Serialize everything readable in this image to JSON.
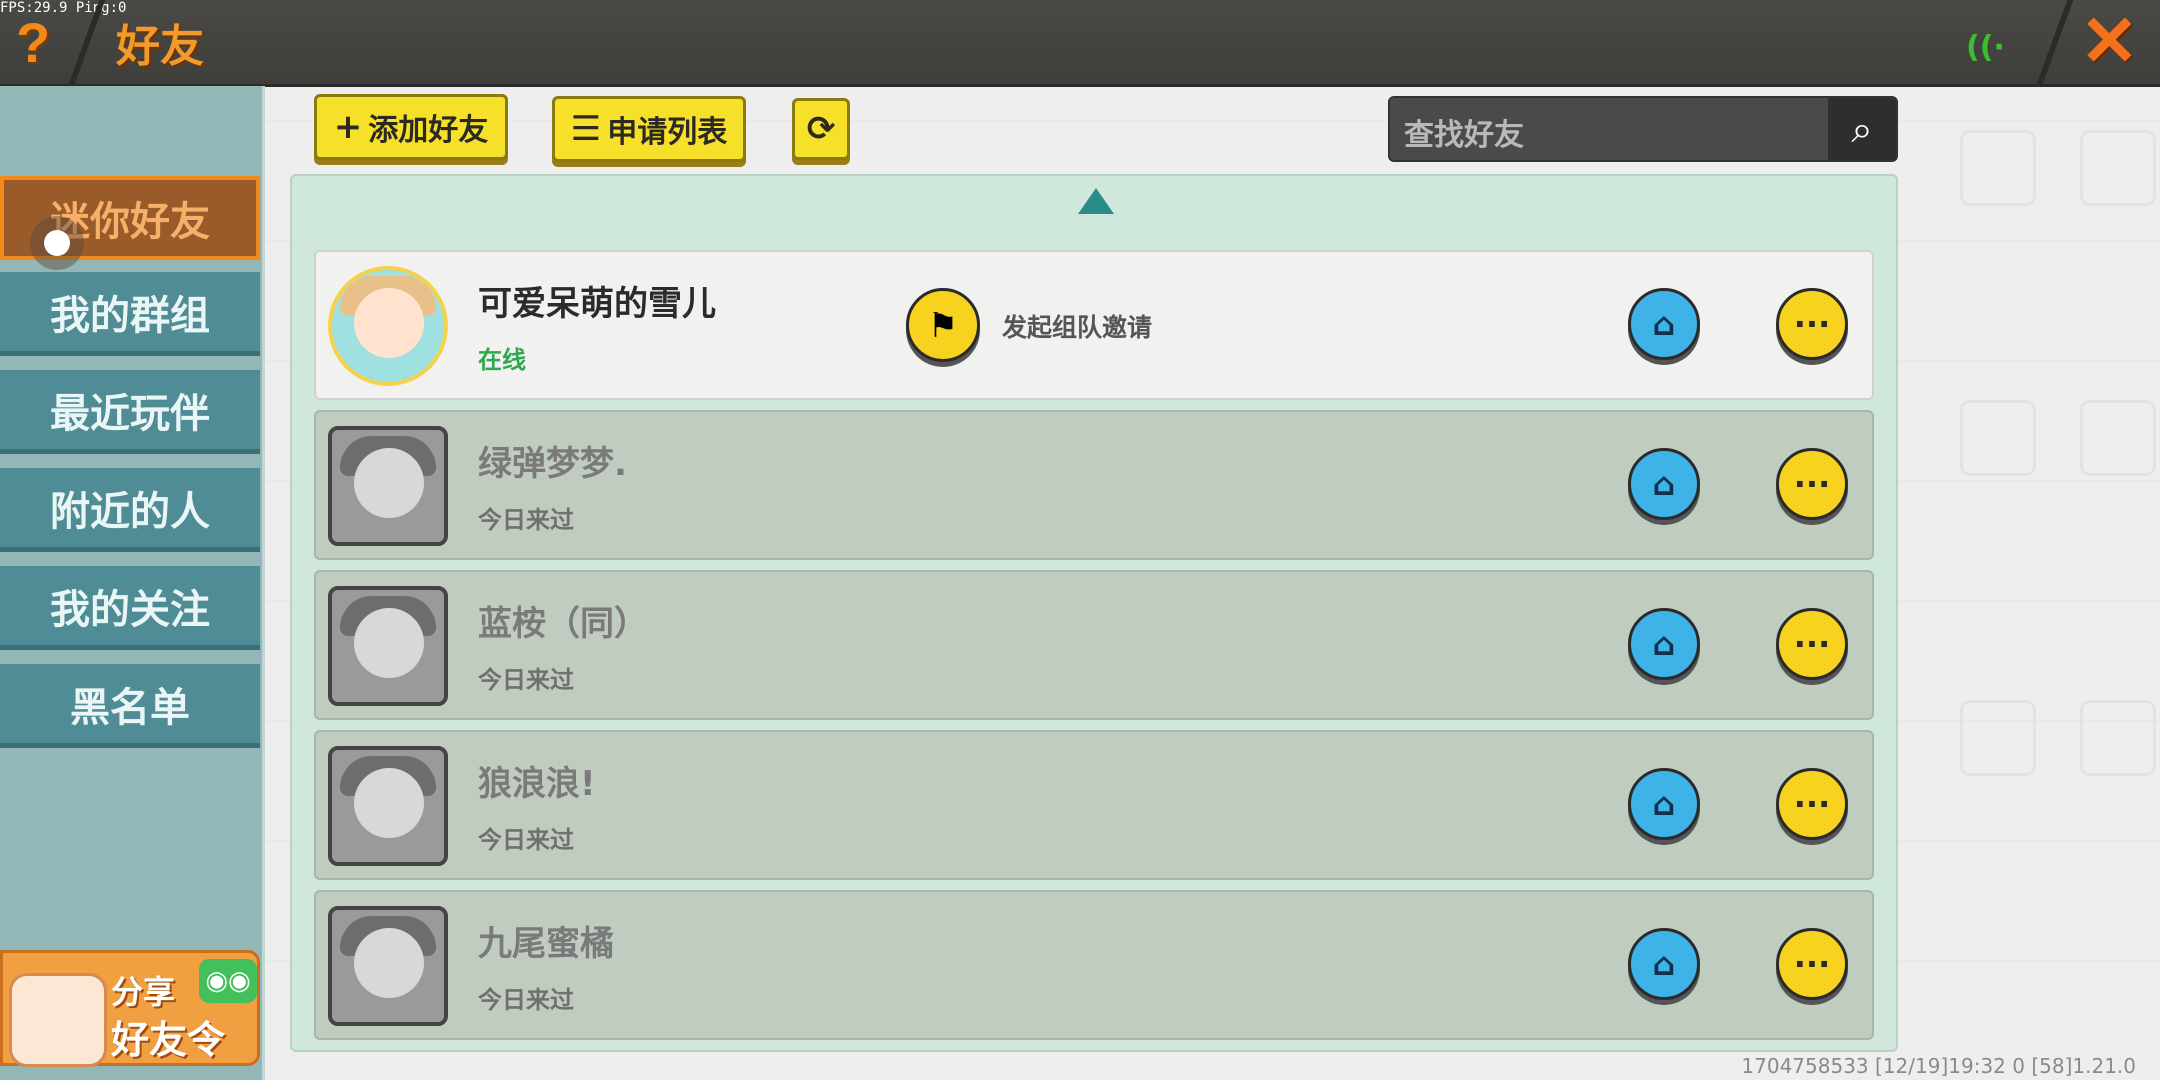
{
  "topbar": {
    "fps_text": "FPS:29.9  Ping:0",
    "help_icon": "?",
    "title": "好友",
    "signal_icon": "wifi-signal-icon",
    "close_icon": "✕"
  },
  "sidebar": {
    "items": [
      {
        "label": "迷你好友",
        "active": true
      },
      {
        "label": "我的群组",
        "active": false
      },
      {
        "label": "最近玩伴",
        "active": false
      },
      {
        "label": "附近的人",
        "active": false
      },
      {
        "label": "我的关注",
        "active": false
      },
      {
        "label": "黑名单",
        "active": false
      }
    ],
    "share": {
      "line1": "分享",
      "line2": "好友令"
    }
  },
  "toolbar": {
    "add_friend_label": "添加好友",
    "apply_list_label": "申请列表",
    "search_placeholder": "查找好友"
  },
  "friends": [
    {
      "name": "可爱呆萌的雪儿",
      "status": "在线",
      "online": true,
      "invite_label": "发起组队邀请"
    },
    {
      "name": "绿弹梦梦.",
      "status": "今日来过",
      "online": false
    },
    {
      "name": "蓝桉（同）",
      "status": "今日来过",
      "online": false
    },
    {
      "name": "狼浪浪!",
      "status": "今日来过",
      "online": false
    },
    {
      "name": "九尾蜜橘",
      "status": "今日来过",
      "online": false
    }
  ],
  "footer": {
    "text": "1704758533    [12/19]19:32 0   [58]1.21.0"
  },
  "colors": {
    "accent_orange": "#f28a1a",
    "sidebar_teal": "#4f8c96",
    "button_yellow": "#f7e02a",
    "online_green": "#2ea84f"
  }
}
